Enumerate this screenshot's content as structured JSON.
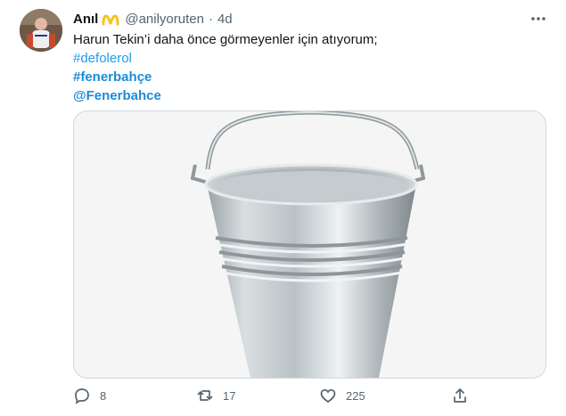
{
  "tweet": {
    "author_name": "Anıl",
    "handle": "@anilyoruten",
    "separator": "·",
    "time": "4d",
    "text_line": "Harun Tekin’i daha önce görmeyenler için atıyorum;",
    "hashtags": [
      "#defolerol",
      "#fenerbahçe"
    ],
    "mention": "@Fenerbahce",
    "media_description": "bucket",
    "icons": {
      "badge": "mcdonalds-badge-icon",
      "more": "more-icon",
      "reply": "reply-icon",
      "retweet": "retweet-icon",
      "like": "like-icon",
      "share": "share-icon"
    },
    "counts": {
      "replies": "8",
      "retweets": "17",
      "likes": "225"
    },
    "colors": {
      "link": "#1d9bf0",
      "secondary_text": "#536471",
      "badge_yellow": "#f6c51b"
    }
  }
}
